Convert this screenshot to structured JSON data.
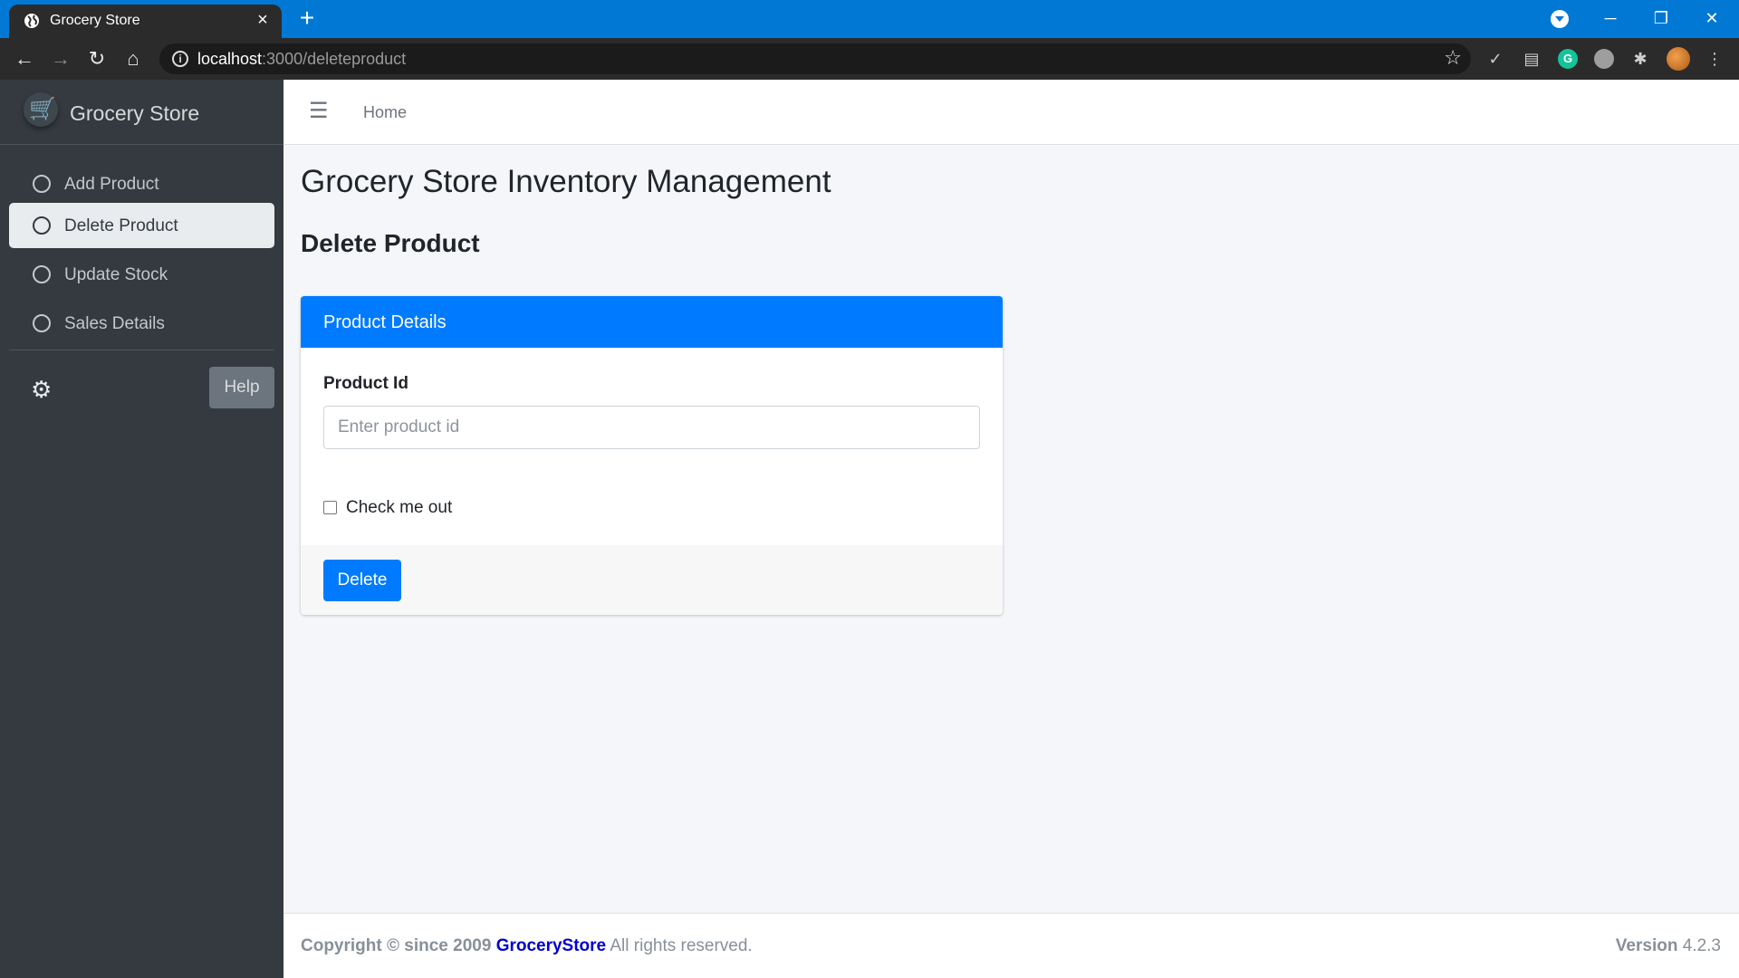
{
  "browser": {
    "tab_title": "Grocery Store",
    "url_host": "localhost",
    "url_rest": ":3000/deleteproduct",
    "window_controls": {
      "minimize": "─",
      "restore": "❐",
      "close": "✕"
    }
  },
  "colors": {
    "primary": "#007bff",
    "sidebar_bg": "#343a40",
    "browser_accent": "#0078d4"
  },
  "sidebar": {
    "brand": "Grocery Store",
    "items": [
      {
        "label": "Add Product",
        "active": false
      },
      {
        "label": "Delete Product",
        "active": true
      },
      {
        "label": "Update Stock",
        "active": false
      },
      {
        "label": "Sales Details",
        "active": false
      }
    ],
    "help_label": "Help"
  },
  "header": {
    "home_label": "Home"
  },
  "main": {
    "page_title": "Grocery Store Inventory Management",
    "section_title": "Delete Product",
    "card": {
      "title": "Product Details",
      "field_label": "Product Id",
      "field_placeholder": "Enter product id",
      "field_value": "",
      "checkbox_label": "Check me out",
      "checkbox_checked": false,
      "submit_label": "Delete"
    }
  },
  "footer": {
    "copyright_prefix": "Copyright © since 2009",
    "brand": "GroceryStore",
    "rights": "All rights reserved.",
    "version_label": "Version",
    "version_number": "4.2.3"
  }
}
